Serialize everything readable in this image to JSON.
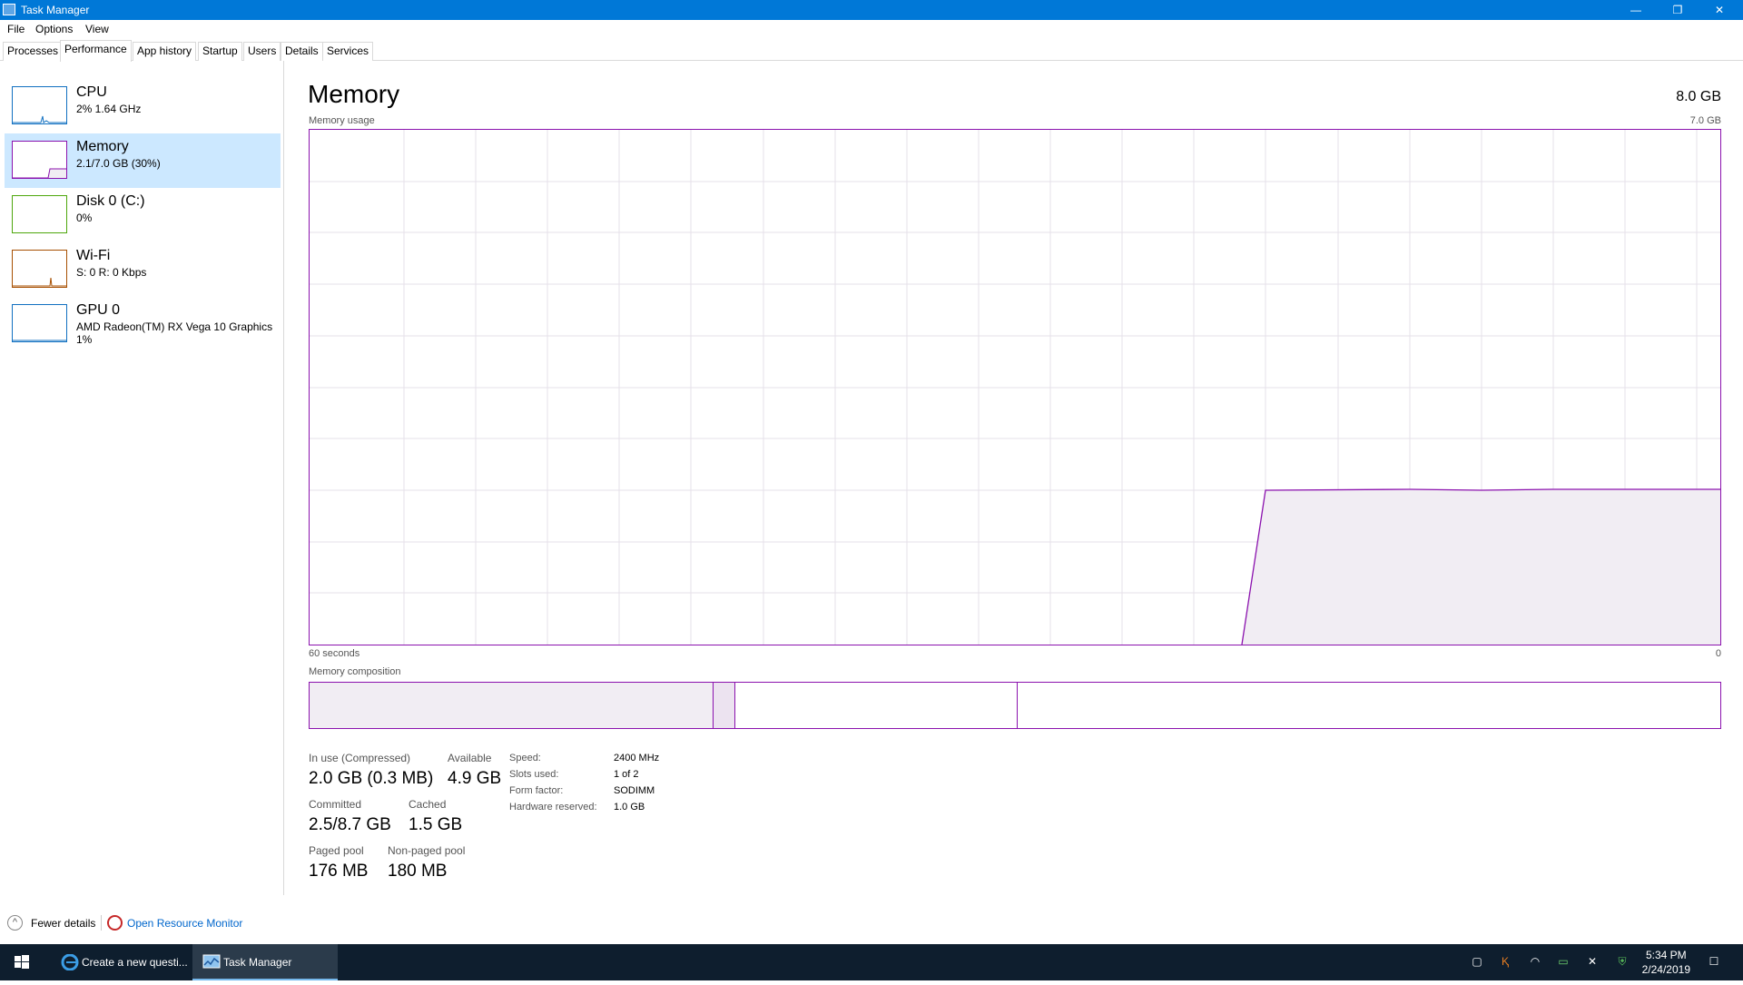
{
  "window": {
    "title": "Task Manager",
    "controls": {
      "minimize": "—",
      "restore": "❐",
      "close": "✕"
    }
  },
  "menu": [
    "File",
    "Options",
    "View"
  ],
  "tabs": [
    "Processes",
    "Performance",
    "App history",
    "Startup",
    "Users",
    "Details",
    "Services"
  ],
  "active_tab": "Performance",
  "sidebar": {
    "items": [
      {
        "title": "CPU",
        "sub": "2% 1.64 GHz",
        "sub2": "",
        "color": "#1170c1",
        "selected": false
      },
      {
        "title": "Memory",
        "sub": "2.1/7.0 GB (30%)",
        "sub2": "",
        "color": "#8b12ae",
        "selected": true
      },
      {
        "title": "Disk 0 (C:)",
        "sub": "0%",
        "sub2": "",
        "color": "#4da60c",
        "selected": false
      },
      {
        "title": "Wi-Fi",
        "sub": "S: 0 R: 0 Kbps",
        "sub2": "",
        "color": "#a74f01",
        "selected": false
      },
      {
        "title": "GPU 0",
        "sub": "AMD Radeon(TM) RX Vega 10 Graphics",
        "sub2": "1%",
        "color": "#1170c1",
        "selected": false
      }
    ]
  },
  "main": {
    "title": "Memory",
    "total": "8.0 GB",
    "usage_label": "Memory usage",
    "usage_max": "7.0 GB",
    "axis_left": "60 seconds",
    "axis_right": "0",
    "composition_label": "Memory composition"
  },
  "stats": {
    "in_use_label": "In use (Compressed)",
    "in_use_value": "2.0 GB (0.3 MB)",
    "available_label": "Available",
    "available_value": "4.9 GB",
    "committed_label": "Committed",
    "committed_value": "2.5/8.7 GB",
    "cached_label": "Cached",
    "cached_value": "1.5 GB",
    "paged_label": "Paged pool",
    "paged_value": "176 MB",
    "nonpaged_label": "Non-paged pool",
    "nonpaged_value": "180 MB"
  },
  "info": [
    {
      "label": "Speed:",
      "value": "2400 MHz"
    },
    {
      "label": "Slots used:",
      "value": "1 of 2"
    },
    {
      "label": "Form factor:",
      "value": "SODIMM"
    },
    {
      "label": "Hardware reserved:",
      "value": "1.0 GB"
    }
  ],
  "footer": {
    "fewer": "Fewer details",
    "resmon": "Open Resource Monitor"
  },
  "taskbar": {
    "items": [
      {
        "label": "Create a new questi...",
        "icon": "edge-icon",
        "active": false
      },
      {
        "label": "Task Manager",
        "icon": "task-manager-icon",
        "active": true
      }
    ],
    "time": "5:34 PM",
    "date": "2/24/2019"
  },
  "colors": {
    "accent": "#0078d7",
    "memory": "#8b12ae",
    "memory_fill": "#f1edf3",
    "grid": "#e6e1ea"
  }
}
